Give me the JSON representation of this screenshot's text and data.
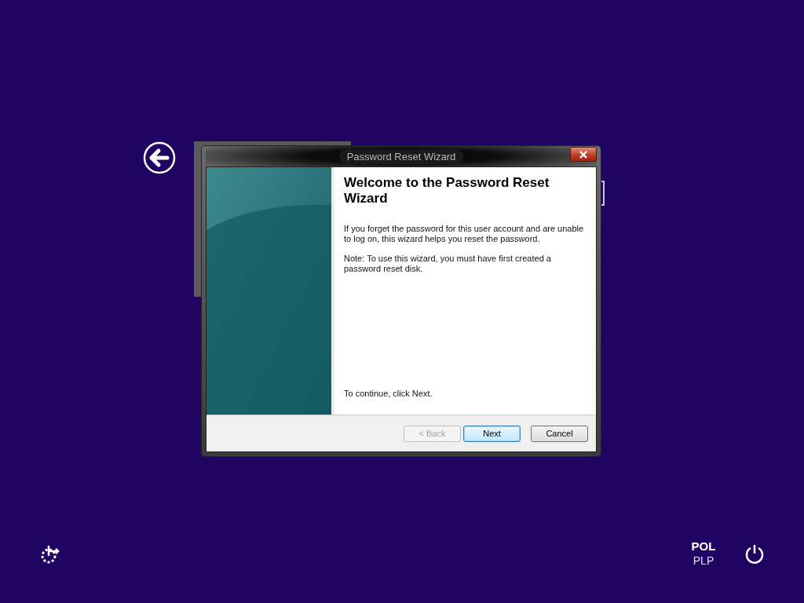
{
  "dialog": {
    "title": "Password Reset Wizard",
    "heading": "Welcome to the Password Reset Wizard",
    "paragraphs": [
      "If you forget the password for this user account and are unable to log on, this wizard helps you reset the password.",
      "Note: To use this wizard, you must have first created a password reset disk."
    ],
    "footer_text": "To continue, click Next.",
    "buttons": [
      {
        "label": "< Back",
        "disabled": true,
        "selected": false
      },
      {
        "label": "Next",
        "disabled": false,
        "selected": true
      },
      {
        "label": "Cancel",
        "disabled": false,
        "selected": false
      }
    ]
  },
  "language": {
    "code": "POL",
    "layout": "PLP"
  }
}
